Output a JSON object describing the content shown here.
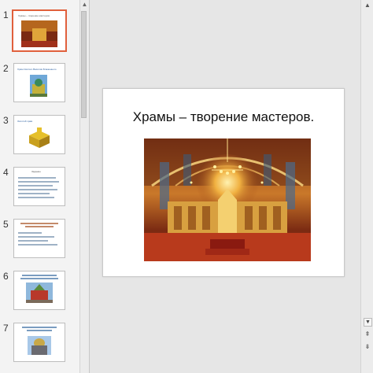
{
  "thumbnails": [
    {
      "number": "1",
      "title": "Храмы – творение мастеров.",
      "selected": true
    },
    {
      "number": "2",
      "title": "Храм Святого Василия Блаженного",
      "selected": false
    },
    {
      "number": "3",
      "title": "Золотой храм",
      "selected": false
    },
    {
      "number": "4",
      "title": "Задание",
      "selected": false
    },
    {
      "number": "5",
      "title": "",
      "selected": false
    },
    {
      "number": "6",
      "title": "",
      "selected": false
    },
    {
      "number": "7",
      "title": "",
      "selected": false
    }
  ],
  "slide": {
    "title": "Храмы – творение мастеров."
  },
  "scroll": {
    "up": "▲",
    "down": "▼",
    "prev": "⇞",
    "next": "⇟"
  },
  "colors": {
    "selection": "#e0603c",
    "gold": "#d4a62a",
    "red": "#b02a1a"
  }
}
